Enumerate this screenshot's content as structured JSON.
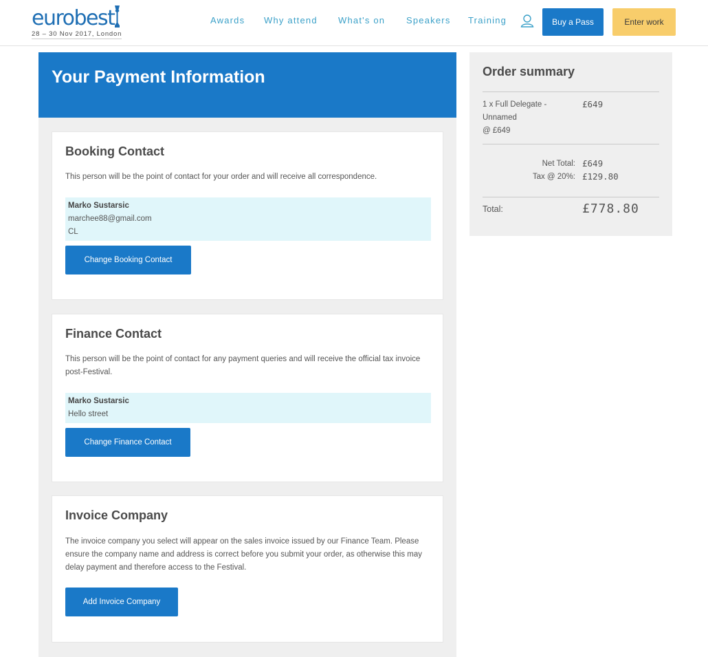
{
  "brand": {
    "name": "eurobest",
    "dates": "28 – 30 Nov 2017, London",
    "accent": "#1a79c8",
    "nav_color": "#3aa0c8",
    "cta_secondary": "#f8cd6b",
    "contact_bg": "#e0f6fa"
  },
  "nav": {
    "items": [
      "Awards",
      "Why attend",
      "What's on",
      "Speakers",
      "Training"
    ],
    "user_icon": "user-icon",
    "buy_pass": "Buy a Pass",
    "enter_work": "Enter work"
  },
  "page": {
    "title": "Your Payment Information"
  },
  "booking": {
    "heading": "Booking Contact",
    "desc": "This person will be the point of contact for your order and will receive all correspondence.",
    "contact_name": "Marko Sustarsic",
    "contact_email": "marchee88@gmail.com",
    "contact_extra": "CL",
    "button": "Change Booking Contact"
  },
  "finance": {
    "heading": "Finance Contact",
    "desc": "This person will be the point of contact for any payment queries and will receive the official tax invoice post-Festival.",
    "contact_name": "Marko Sustarsic",
    "contact_address": "Hello street",
    "button": "Change Finance Contact"
  },
  "invoice": {
    "heading": "Invoice Company",
    "desc": "The invoice company you select will appear on the sales invoice issued by our Finance Team. Please ensure the company name and address is correct before you submit your order, as otherwise this may delay payment and therefore access to the Festival.",
    "button": "Add Invoice Company"
  },
  "summary": {
    "heading": "Order summary",
    "item": {
      "line1": "1 x Full Delegate -",
      "line2": "Unnamed",
      "line3": "@ £649",
      "price": "£649"
    },
    "net_label": "Net Total:",
    "net_value": "£649",
    "tax_label": "Tax @ 20%:",
    "tax_value": "£129.80",
    "total_label": "Total:",
    "total_value": "£778.80"
  }
}
